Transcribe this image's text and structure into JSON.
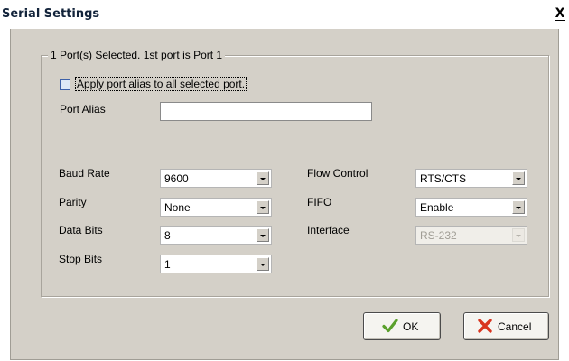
{
  "window": {
    "title": "Serial Settings",
    "close_glyph": "X"
  },
  "group": {
    "legend": "1 Port(s) Selected. 1st port is Port 1",
    "apply_alias_label": "Apply port alias to all selected port.",
    "apply_alias_checked": false,
    "port_alias_label": "Port Alias",
    "port_alias_value": ""
  },
  "fields": {
    "baud_rate": {
      "label": "Baud Rate",
      "value": "9600"
    },
    "parity": {
      "label": "Parity",
      "value": "None"
    },
    "data_bits": {
      "label": "Data Bits",
      "value": "8"
    },
    "stop_bits": {
      "label": "Stop Bits",
      "value": "1"
    },
    "flow_control": {
      "label": "Flow Control",
      "value": "RTS/CTS"
    },
    "fifo": {
      "label": "FIFO",
      "value": "Enable"
    },
    "interface": {
      "label": "Interface",
      "value": "RS-232",
      "disabled": true
    }
  },
  "buttons": {
    "ok": {
      "label": "OK",
      "icon": "checkmark-icon"
    },
    "cancel": {
      "label": "Cancel",
      "icon": "red-x-icon"
    }
  },
  "colors": {
    "panel_bg": "#d4d0c8",
    "title_text": "#12233a",
    "ok_check": "#5aa02c",
    "cancel_x": "#d9351f",
    "checkbox_border": "#3c60a8"
  }
}
